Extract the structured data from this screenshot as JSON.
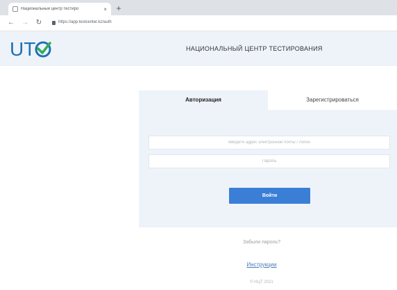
{
  "browser": {
    "tab_title": "Национальный центр тестиро",
    "tab_close": "×",
    "new_tab": "+",
    "back": "←",
    "forward": "→",
    "reload": "↻",
    "url": "https://app.testcenter.kz/auth"
  },
  "header": {
    "logo_text": "UT",
    "title": "НАЦИОНАЛЬНЫЙ ЦЕНТР ТЕСТИРОВАНИЯ",
    "colors": {
      "logo_blue": "#1e6fb6",
      "logo_check": "#2fae54"
    }
  },
  "auth": {
    "tabs": [
      {
        "label": "Авторизация",
        "active": true
      },
      {
        "label": "Зарегистрироваться",
        "active": false
      }
    ],
    "login_placeholder": "Введите адрес электронной почты / Логин",
    "password_placeholder": "Пароль",
    "submit_label": "Войти",
    "colors": {
      "button": "#3b7ed6",
      "panel": "#eef3f9"
    }
  },
  "footer": {
    "forgot_label": "Забыли пароль?",
    "instructions_label": "Инструкции",
    "copyright": "© НЦТ 2021"
  }
}
